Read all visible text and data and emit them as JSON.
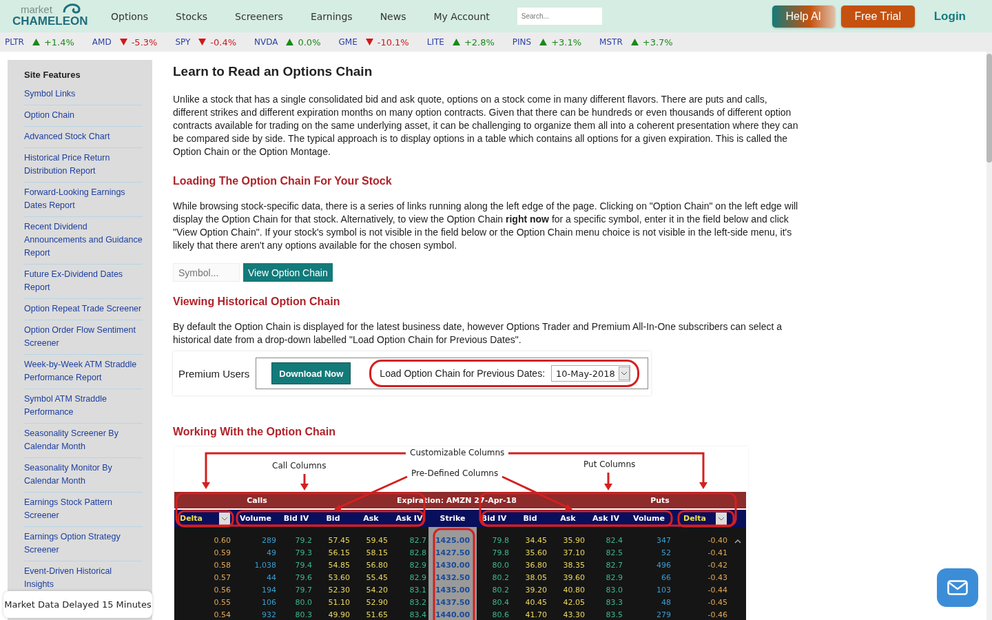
{
  "header": {
    "logo": {
      "top": "market",
      "bottom": "CHAMELEON"
    },
    "nav": [
      "Options",
      "Stocks",
      "Screeners",
      "Earnings",
      "News",
      "My Account"
    ],
    "search": {
      "placeholder": "Search..."
    },
    "buttons": [
      {
        "label": "Help AI",
        "kind": "gradient"
      },
      {
        "label": "Free Trial",
        "kind": "solid"
      }
    ],
    "login": "Login"
  },
  "ticker": [
    {
      "symbol": "PLTR",
      "up": true,
      "change": "+1.4%"
    },
    {
      "symbol": "AMD",
      "up": false,
      "change": "-5.3%"
    },
    {
      "symbol": "SPY",
      "up": false,
      "change": "-0.4%"
    },
    {
      "symbol": "NVDA",
      "up": true,
      "change": "0.0%"
    },
    {
      "symbol": "GME",
      "up": false,
      "change": "-10.1%"
    },
    {
      "symbol": "LITE",
      "up": true,
      "change": "+2.8%"
    },
    {
      "symbol": "PINS",
      "up": true,
      "change": "+3.1%"
    },
    {
      "symbol": "MSTR",
      "up": true,
      "change": "+3.7%"
    }
  ],
  "sidebar": {
    "title": "Site Features",
    "items": [
      "Symbol Links",
      "Option Chain",
      "Advanced Stock Chart",
      "Historical Price Return Distribution Report",
      "Forward-Looking Earnings Dates Report",
      "Recent Dividend Announcements and Guidance Report",
      "Future Ex-Dividend Dates Report",
      "Option Repeat Trade Screener",
      "Option Order Flow Sentiment Screener",
      "Week-by-Week ATM Straddle Performance Report",
      "Symbol ATM Straddle Performance",
      "Seasonality Screener By Calendar Month",
      "Seasonality Monitor By Calendar Month",
      "Earnings Stock Pattern Screener",
      "Earnings Option Strategy Screener",
      "Event-Driven Historical Insights"
    ]
  },
  "toast": "Market Data Delayed 15 Minutes",
  "article": {
    "title": "Learn to Read an Options Chain",
    "intro": "Unlike a stock that has a single consolidated bid and ask quote, options on a stock come in many different flavors. There are puts and calls, different strikes and different expiration months on many option contracts. Given that there can be hundreds or even thousands of different option contracts available for trading on the same underlying asset, it can be challenging to organize them all into a coherent presentation where they can be compared side by side. The typical approach is to display options in a table which contains all options for a given expiration. This is called the Option Chain or the Option Montage.",
    "loading": {
      "heading": "Loading The Option Chain For Your Stock",
      "paragraph": "While browsing stock-specific data, there is a series of links running along the left edge of the page. Clicking on \"Option Chain\" on the left edge will display the Option Chain for that stock. Alternatively, to view the Option Chain **right now** for a specific symbol, enter it in the field below and click \"View Option Chain\". If your stock's symbol is not visible in the field below or the Option Chain menu choice is not visible in the left-side menu, it's likely that there aren't any options available for the chosen symbol.",
      "symbol_field": {
        "placeholder": "Symbol..."
      },
      "button": "View Option Chain"
    },
    "historical": {
      "heading": "Viewing Historical Option Chain",
      "paragraph": "By default the Option Chain is displayed for the latest business date, however Options Trader and Premium All-In-One subscribers can select a historical date from a drop-down labelled \"Load Option Chain for Previous Dates\".",
      "premium": {
        "label": "Premium Users",
        "download_button": "Download Now",
        "date_label": "Load Option Chain for Previous Dates:",
        "date_value": "10-May-2018"
      }
    },
    "working": {
      "heading": "Working With the Option Chain",
      "figure": {
        "annotations": [
          "Customizable Columns",
          "Call Columns",
          "Pre-Defined Columns",
          "Put Columns"
        ],
        "title_bar": {
          "left": "Calls",
          "center": "Expiration: AMZN 27-Apr-18",
          "right": "Puts"
        },
        "call_columns": [
          "Delta",
          "Volume",
          "Bid IV",
          "Bid",
          "Ask",
          "Ask IV"
        ],
        "strike_column": "Strike",
        "put_columns": [
          "Bid IV",
          "Bid",
          "Ask",
          "Ask IV",
          "Volume",
          "Delta"
        ],
        "rows": [
          {
            "call": [
              "0.60",
              "289",
              "79.2",
              "57.45",
              "59.45",
              "82.7"
            ],
            "strike": "1425.00",
            "put": [
              "79.8",
              "34.45",
              "35.90",
              "82.4",
              "347",
              "-0.40"
            ]
          },
          {
            "call": [
              "0.59",
              "49",
              "79.3",
              "56.15",
              "58.15",
              "82.8"
            ],
            "strike": "1427.50",
            "put": [
              "79.8",
              "35.60",
              "37.10",
              "82.5",
              "52",
              "-0.41"
            ]
          },
          {
            "call": [
              "0.58",
              "1,038",
              "79.4",
              "54.85",
              "56.80",
              "82.9"
            ],
            "strike": "1430.00",
            "put": [
              "80.0",
              "36.80",
              "38.35",
              "82.7",
              "496",
              "-0.42"
            ]
          },
          {
            "call": [
              "0.57",
              "44",
              "79.6",
              "53.60",
              "55.45",
              "82.9"
            ],
            "strike": "1432.50",
            "put": [
              "80.2",
              "38.05",
              "39.60",
              "82.9",
              "66",
              "-0.43"
            ]
          },
          {
            "call": [
              "0.56",
              "194",
              "79.7",
              "52.30",
              "54.20",
              "83.1"
            ],
            "strike": "1435.00",
            "put": [
              "80.2",
              "39.20",
              "40.80",
              "83.0",
              "103",
              "-0.44"
            ]
          },
          {
            "call": [
              "0.55",
              "106",
              "80.0",
              "51.10",
              "52.90",
              "83.2"
            ],
            "strike": "1437.50",
            "put": [
              "80.4",
              "40.45",
              "42.05",
              "83.3",
              "48",
              "-0.45"
            ]
          },
          {
            "call": [
              "0.54",
              "932",
              "80.3",
              "49.90",
              "51.65",
              "83.4"
            ],
            "strike": "1440.00",
            "put": [
              "80.6",
              "41.70",
              "43.30",
              "83.5",
              "279",
              "-0.46"
            ]
          }
        ]
      }
    }
  }
}
